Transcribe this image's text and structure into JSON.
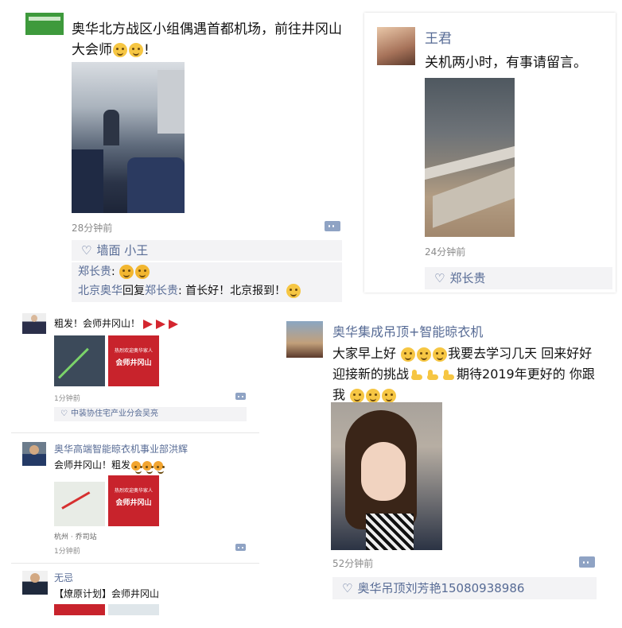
{
  "posts": {
    "p1": {
      "author": "",
      "text": "奥华北方战区小组偶遇首都机场，前往井冈山大会师",
      "text_end": "!",
      "time": "28分钟前",
      "likes": "墙面 小王",
      "comments": [
        {
          "name": "郑长贵",
          "text": ": "
        },
        {
          "name": "北京奥华",
          "reply": "回复",
          "name2": "郑长贵",
          "text": ": 首长好！北京报到！"
        }
      ]
    },
    "p2": {
      "author": "王君",
      "text": "关机两小时，有事请留言。",
      "time": "24分钟前",
      "likes": "郑长贵"
    },
    "p3": {
      "author": "",
      "text": "粗发！会师井冈山！",
      "banner_line1": "热烈欢迎奥华家人",
      "banner_line2": "会师井冈山",
      "time": "1分钟前",
      "likes": "中装协住宅产业分会吴亮"
    },
    "p4": {
      "author": "奥华集成吊顶+智能晾衣机",
      "text_a": "大家早上好",
      "text_b": "我要去学习几天 回来好好迎接新的挑战",
      "text_c": "期待2019年更好的 你跟我",
      "time": "52分钟前",
      "likes": "奥华吊顶刘芳艳15080938986"
    },
    "p5": {
      "author": "奥华高端智能晾衣机事业部洪辉",
      "text": "会师井冈山！粗发",
      "banner_line1": "热烈欢迎奥华家人",
      "banner_line2": "会师井冈山",
      "location": "杭州 · 乔司站",
      "time": "1分钟前"
    },
    "p6": {
      "author": "无忌",
      "text": "【燎原计划】会师井冈山"
    }
  },
  "colors": {
    "name": "#576b95",
    "banner_red": "#c8232c",
    "like_bg": "#f3f3f5"
  }
}
